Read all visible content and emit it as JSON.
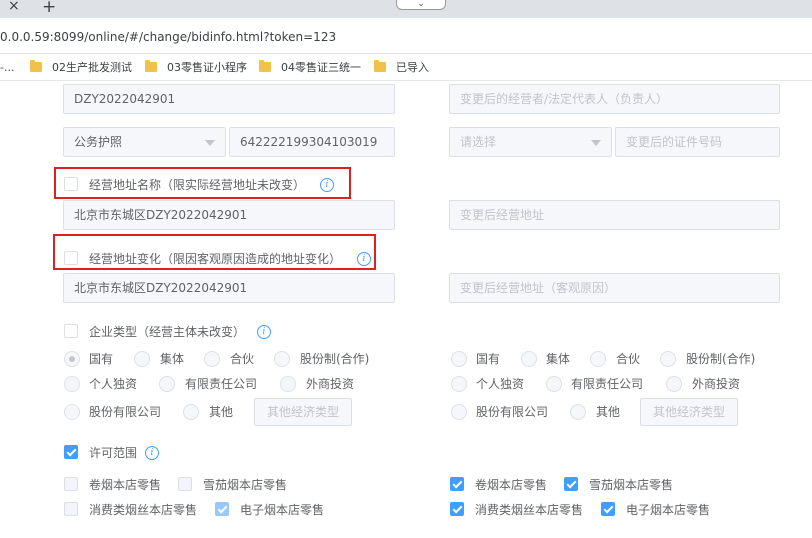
{
  "browser": {
    "tab_close": "×",
    "tab_new": "+",
    "url": "0.0.0.59:8099/online/#/change/bidinfo.html?token=123",
    "bookmarks": [
      "02生产批发测试",
      "03零售证小程序",
      "04零售证三统一",
      "已导入"
    ],
    "bookmark_leading": "-..."
  },
  "form": {
    "reg_no": "DZY2022042901",
    "new_rep_placeholder": "变更后的经营者/法定代表人（负责人）",
    "id_type": "公务护照",
    "id_number": "642222199304103019",
    "new_id_type_placeholder": "请选择",
    "new_id_no_placeholder": "变更后的证件号码",
    "addr_name_label": "经营地址名称（限实际经营地址未改变）",
    "addr_name_value": "北京市东城区DZY2022042901",
    "addr_name_placeholder": "变更后经营地址",
    "addr_change_label": "经营地址变化（限因客观原因造成的地址变化）",
    "addr_change_value": "北京市东城区DZY2022042901",
    "addr_change_placeholder": "变更后经营地址（客观原因）",
    "ent_type_label": "企业类型（经营主体未改变）",
    "ent_types_row1": [
      "国有",
      "集体",
      "合伙",
      "股份制(合作)"
    ],
    "ent_types_row2": [
      "个人独资",
      "有限责任公司",
      "外商投资"
    ],
    "ent_types_row3": [
      "股份有限公司",
      "其他"
    ],
    "other_econ_placeholder": "其他经济类型",
    "license_scope_label": "许可范围",
    "scope_left": [
      "卷烟本店零售",
      "雪茄烟本店零售",
      "消费类烟丝本店零售",
      "电子烟本店零售"
    ],
    "scope_right": [
      "卷烟本店零售",
      "雪茄烟本店零售",
      "消费类烟丝本店零售",
      "电子烟本店零售"
    ]
  },
  "colors": {
    "accent": "#409eff",
    "highlight": "#e02020"
  }
}
